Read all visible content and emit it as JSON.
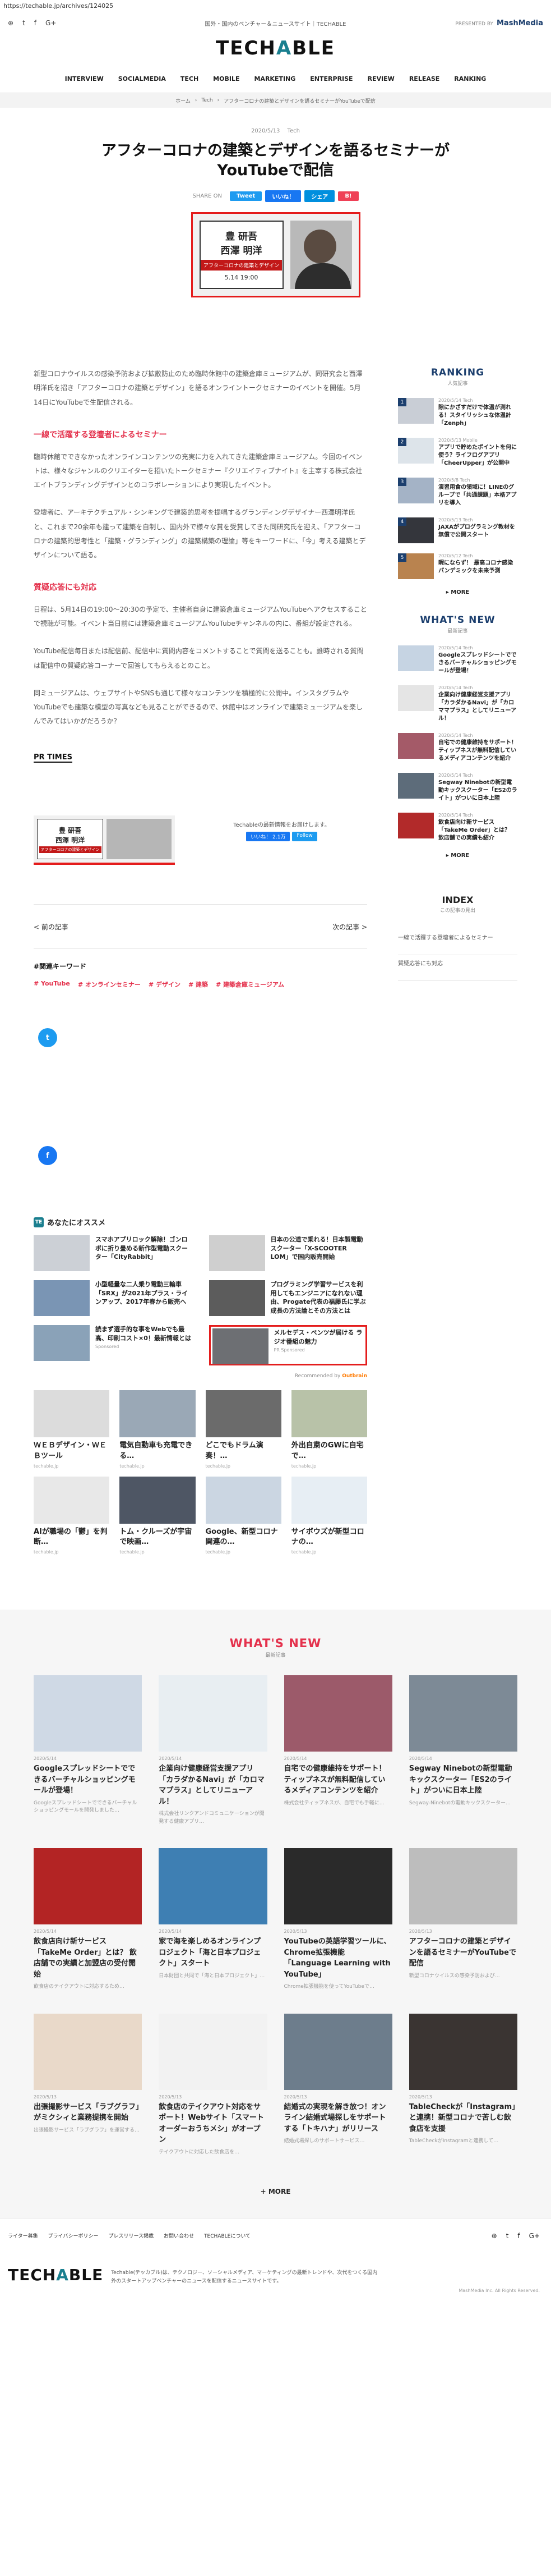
{
  "url": "https://techable.jp/archives/124025",
  "top": {
    "tagline": "国外・国内のベンチャー＆ニュースサイト｜TECHABLE",
    "presented_by": "PRESENTED BY",
    "presenter": "MashMedia"
  },
  "logo": {
    "part1": "TECH",
    "part2": "A",
    "part3": "BLE"
  },
  "nav": [
    "INTERVIEW",
    "SOCIALMEDIA",
    "TECH",
    "MOBILE",
    "MARKETING",
    "ENTERPRISE",
    "REVIEW",
    "RELEASE",
    "RANKING"
  ],
  "breadcrumb": [
    "ホーム",
    "Tech",
    "アフターコロナの建築とデザインを語るセミナーがYouTubeで配信"
  ],
  "article": {
    "date": "2020/5/13",
    "category": "Tech",
    "title_line1": "アフターコロナの建築とデザインを語るセミナーが",
    "title_line2": "YouTubeで配信",
    "share_label": "SHARE ON",
    "share_buttons": [
      "Tweet",
      "いいね！",
      "シェア",
      "B!"
    ],
    "hero": {
      "name_top": "豊 研吾",
      "name_bottom": "西澤 明洋",
      "ribbon": "アフターコロナの建築とデザイン",
      "date": "5.14 19:00"
    },
    "paragraphs": [
      "新型コロナウイルスの感染予防および拡散防止のため臨時休館中の建築倉庫ミュージアムが、同研究会と西澤明洋氏を招き「アフターコロナの建築とデザイン」を語るオンライントークセミナーのイベントを開催。5月14日にYouTubeで生配信される。",
      "臨時休館でできなかったオンラインコンテンツの充実に力を入れてきた建築倉庫ミュージアム。今回のイベントは、様々なジャンルのクリエイターを招いたトークセミナー『クリエイティブナイト』を主宰する株式会社エイトブランディングデザインとのコラボレーションにより実現したイベント。",
      "登壇者に、アーキテクチュアル・シンキングで建築的思考を提唱するグランディングデザイナー西澤明洋氏と、これまで20余年も建って建築を自制し、国内外で様々な賞を受賞してきた同研究氏を迎え、「アフターコロナの建築的思考性と「建築・グランディング」の建築構築の理論」等をキーワードに、「今」考える建築とデザインについて語る。",
      "日程は、5月14日の19:00〜20:30の予定で、主催者自身に建築倉庫ミュージアムYouTubeへアクセスすることで視聴が可能。イベント当日前には建築倉庫ミュージアムYouTubeチャンネルの内に、番組が設定される。",
      "YouTube配信毎日または配信前、配信中に質問内容をコメントすることで質問を送ることも。誰時される質問は配信中の質疑応答コーナーで回答してもらえるとのこと。",
      "同ミュージアムは、ウェブサイトやSNSも通じて様々なコンテンツを積極的に公開中。インスタグラムやYouTubeでも建築な模型の写真なども見ることができるので、休館中はオンラインで建築ミュージアムを楽しんでみてはいかがだろうか？"
    ],
    "heading1": "一線で活躍する登壇者によるセミナー",
    "heading2": "質疑応答にも対応",
    "source": "PR TIMES"
  },
  "banner": {
    "name_top": "豊 研吾",
    "name_bottom": "西澤 明洋",
    "ribbon": "アフターコロナの建築とデザイン",
    "follow_text": "Techableの最新情報をお届けします。",
    "follow_like": "いいね！ 2.1万",
    "follow_twitter": "Follow"
  },
  "pager": {
    "prev": "< 前の記事",
    "next": "次の記事 >"
  },
  "keywords": {
    "title": "#関連キーワード",
    "tags": [
      "# YouTube",
      "# オンラインセミナー",
      "# デザイン",
      "# 建築",
      "# 建築倉庫ミュージアム"
    ]
  },
  "share_circles": {
    "twitter": "t",
    "facebook": "f"
  },
  "recommend": {
    "logo": "TE",
    "title": "あなたにオススメ",
    "items": [
      {
        "text": "スマホアプリロック解除！ゴンロボに折り畳める新作型電動スクーター「CityRabbit」",
        "sponsor": "",
        "color": "#ccd0d6"
      },
      {
        "text": "日本の公道で乗れる！日本製電動スクーター「X-SCOOTER LOM」で国内販売開始",
        "sponsor": "",
        "color": "#cfcfcf"
      },
      {
        "text": "小型軽量な二人乗り電動三輪車「SRX」が2021年プラス・ラインアップ、2017年春から販売へ",
        "sponsor": "",
        "color": "#7a95b4"
      },
      {
        "text": "プログラミング学習サービスを利用してもエンジニアになれない理由、Progate代表の福藤氏に学ぶ成長の方法論とその方法とは",
        "sponsor": "",
        "color": "#5c5c5c"
      },
      {
        "text": "読まず選手的な事をWebでも最高、印刷コスト×0！最新情報とは",
        "sponsor": "Sponsored",
        "color": "#8aa2b8"
      },
      {
        "text": "メルセデス・ベンツが届ける ラジオ番組の魅力",
        "sponsor": "PR Sponsored",
        "color": "#6d6f73"
      }
    ],
    "footer_text": "Recommended by",
    "footer_brand": "Outbrain"
  },
  "external": [
    {
      "text": "ＷＥＢデザイン・ＷＥＢツール",
      "sponsor": "techable.jp",
      "color": "#dcdcdc"
    },
    {
      "text": "電気自動車も充電できる…",
      "sponsor": "techable.jp",
      "color": "#9aa8b6"
    },
    {
      "text": "どこでもドラム演奏！…",
      "sponsor": "techable.jp",
      "color": "#6b6b6b"
    },
    {
      "text": "外出自粛のGWに自宅で…",
      "sponsor": "techable.jp",
      "color": "#b8c2a8"
    },
    {
      "text": "AIが職場の「鬱」を判断…",
      "sponsor": "techable.jp",
      "color": "#e8e8e8"
    },
    {
      "text": "トム・クルーズが宇宙で映画…",
      "sponsor": "techable.jp",
      "color": "#4e5664"
    },
    {
      "text": "Google、新型コロナ関連の…",
      "sponsor": "techable.jp",
      "color": "#cbd6e2"
    },
    {
      "text": "サイボウズが新型コロナの…",
      "sponsor": "techable.jp",
      "color": "#e7eef4"
    }
  ],
  "sidebar": {
    "ranking_title": "RANKING",
    "ranking_sub": "人気記事",
    "ranking": [
      {
        "num": "1",
        "meta": "2020/5/14  Tech",
        "text": "隙にかざすだけで体温が測れる！スタイリッシュな体温計「Zenph」",
        "color": "#c9ced6"
      },
      {
        "num": "2",
        "meta": "2020/5/13  Mobile",
        "text": "アプリで貯めたポイントを何に使う？ライフログアプリ「CheerUpper」が公開中",
        "color": "#dde4ea"
      },
      {
        "num": "3",
        "meta": "2020/5/8  Tech",
        "text": "演習用食の領域に！LINEのグループで「共通課題」本格アプリを導入",
        "color": "#a4b3c6"
      },
      {
        "num": "4",
        "meta": "2020/5/13  Tech",
        "text": "JAXAがプログラミング教材を無償で公開スタート",
        "color": "#34363c"
      },
      {
        "num": "5",
        "meta": "2020/5/12  Tech",
        "text": "暇にならず！ 最高コロナ感染パンデミックを未来予測",
        "color": "#b9834f"
      }
    ],
    "more": "MORE",
    "whatsnew_title": "WHAT'S NEW",
    "whatsnew_sub": "最新記事",
    "whatsnew": [
      {
        "meta": "2020/5/14  Tech",
        "text": "Googleスプレッドシートでできるバーチャルショッピングモールが登場！",
        "color": "#c6d4e3"
      },
      {
        "meta": "2020/5/14  Tech",
        "text": "企業向け健康経営支援アプリ「カラダかるNavi」が「カロママプラス」としてリニューアル！",
        "color": "#e5e5e5"
      },
      {
        "meta": "2020/5/14  Tech",
        "text": "自宅での健康維持をサポート！ティップネスが無料配信しているメディアコンテンツを紹介",
        "color": "#a45a68"
      },
      {
        "meta": "2020/5/14  Tech",
        "text": "Segway Ninebotの新型電動キックスクーター「ES2のライト」がついに日本上陸",
        "color": "#5d6c7a"
      },
      {
        "meta": "2020/5/14  Tech",
        "text": "飲食店向け新サービス「TakeMe Order」とは？ 飲店舗での実績も紹介",
        "color": "#b22a2a"
      }
    ],
    "index_title": "INDEX",
    "index_sub": "この記事の見出",
    "index_items": [
      "一線で活躍する登壇者によるセミナー",
      "質疑応答にも対応"
    ]
  },
  "whatsnew_section": {
    "title": "WHAT'S NEW",
    "sub": "最新記事",
    "cards": [
      {
        "meta": "2020/5/14",
        "text": "Googleスプレッドシートでできるバーチャルショッピングモールが登場！",
        "desc": "Googleスプレッドシートでできるバーチャルショッピングモールを開発しました…",
        "color": "#cfd9e5"
      },
      {
        "meta": "2020/5/14",
        "text": "企業向け健康経営支援アプリ「カラダかるNavi」が「カロママプラス」としてリニューアル！",
        "desc": "株式会社リンクアンドコミュニケーションが開発する健康アプリ…",
        "color": "#e8eef2"
      },
      {
        "meta": "2020/5/14",
        "text": "自宅での健康維持をサポート！ティップネスが無料配信しているメディアコンテンツを紹介",
        "desc": "株式会社ティップネスが、自宅でも手軽に…",
        "color": "#9c5a6a"
      },
      {
        "meta": "2020/5/14",
        "text": "Segway Ninebotの新型電動キックスクーター「ES2のライト」がついに日本上陸",
        "desc": "Segway-Ninebotの電動キックスクーター…",
        "color": "#7d8a96"
      },
      {
        "meta": "2020/5/14",
        "text": "飲食店向け新サービス「TakeMe Order」とは？ 飲店舗での実績と加盟店の受付開始",
        "desc": "飲食店のテイクアウトに対応するため…",
        "color": "#b32424"
      },
      {
        "meta": "2020/5/14",
        "text": "家で海を楽しめるオンラインプロジェクト「海と日本プロジェクト」スタート",
        "desc": "日本財団と共同で「海と日本プロジェクト」…",
        "color": "#3e7fb3"
      },
      {
        "meta": "2020/5/13",
        "text": "YouTubeの英語学習ツールに、Chrome拡張機能「Language Learning with YouTube」",
        "desc": "Chrome拡張機能を使ってYouTubeで…",
        "color": "#2a2a2a"
      },
      {
        "meta": "2020/5/13",
        "text": "アフターコロナの建築とデザインを語るセミナーがYouTubeで配信",
        "desc": "新型コロナウイルスの感染予防および…",
        "color": "#bdbdbd"
      },
      {
        "meta": "2020/5/13",
        "text": "出張撮影サービス「ラブグラフ」がミクシィと業務提携を開始",
        "desc": "出張撮影サービス「ラブグラフ」を運営する…",
        "color": "#e9d9c9"
      },
      {
        "meta": "2020/5/13",
        "text": "飲食店のテイクアウト対応をサポート！Webサイト「スマートオーダーおうちメシ」がオープン",
        "desc": "テイクアウトに対応した飲食店を…",
        "color": "#f2f2f2"
      },
      {
        "meta": "2020/5/13",
        "text": "結婚式の実現を解き放つ！オンライン結婚式場探しをサポートする「トキハナ」がリリース",
        "desc": "結婚式場探しのサポートサービス…",
        "color": "#6d7d8c"
      },
      {
        "meta": "2020/5/13",
        "text": "TableCheckが「Instagram」と連携！新型コロナで苦しむ飲食店を支援",
        "desc": "TableCheckがInstagramと連携して…",
        "color": "#3a3432"
      }
    ],
    "more": "+ MORE"
  },
  "footer": {
    "links": [
      "ライター募集",
      "プライバシーポリシー",
      "プレスリリース掲載",
      "お問い合わせ",
      "TECHABLEについて"
    ],
    "desc": "Techable(テッカブル)は、テクノロジー、ソーシャルメディア、マーケティングの最新トレンドや、次代をつくる国内外のスタートアップベンチャーのニュースを配信するニュースサイトです。",
    "copyright": "MashMedia Inc. All Rights Reserved."
  }
}
